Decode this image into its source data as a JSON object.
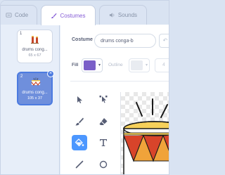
{
  "tabs": {
    "code": "Code",
    "costumes": "Costumes",
    "sounds": "Sounds"
  },
  "costumes": [
    {
      "index": "1",
      "name": "drums cong...",
      "size": "65 x 67",
      "selected": false
    },
    {
      "index": "2",
      "name": "drums cong...",
      "size": "105 x 37",
      "selected": true
    }
  ],
  "editor": {
    "costume_label": "Costume",
    "costume_name": "drums conga-b",
    "fill_label": "Fill",
    "fill_color": "#7a5fc8",
    "outline_label": "Outline",
    "stroke_width": "4"
  },
  "colors": {
    "accent": "#855cd6",
    "selected_card": "#6f8fdc",
    "active_tool": "#4c97ff"
  },
  "icons": {
    "code_tab": "code-icon",
    "costumes_tab": "brush-icon",
    "sounds_tab": "speaker-icon",
    "tools": [
      "select-icon",
      "reshape-icon",
      "brush-icon",
      "eraser-icon",
      "fill-icon",
      "text-icon",
      "line-icon",
      "circle-icon"
    ]
  }
}
